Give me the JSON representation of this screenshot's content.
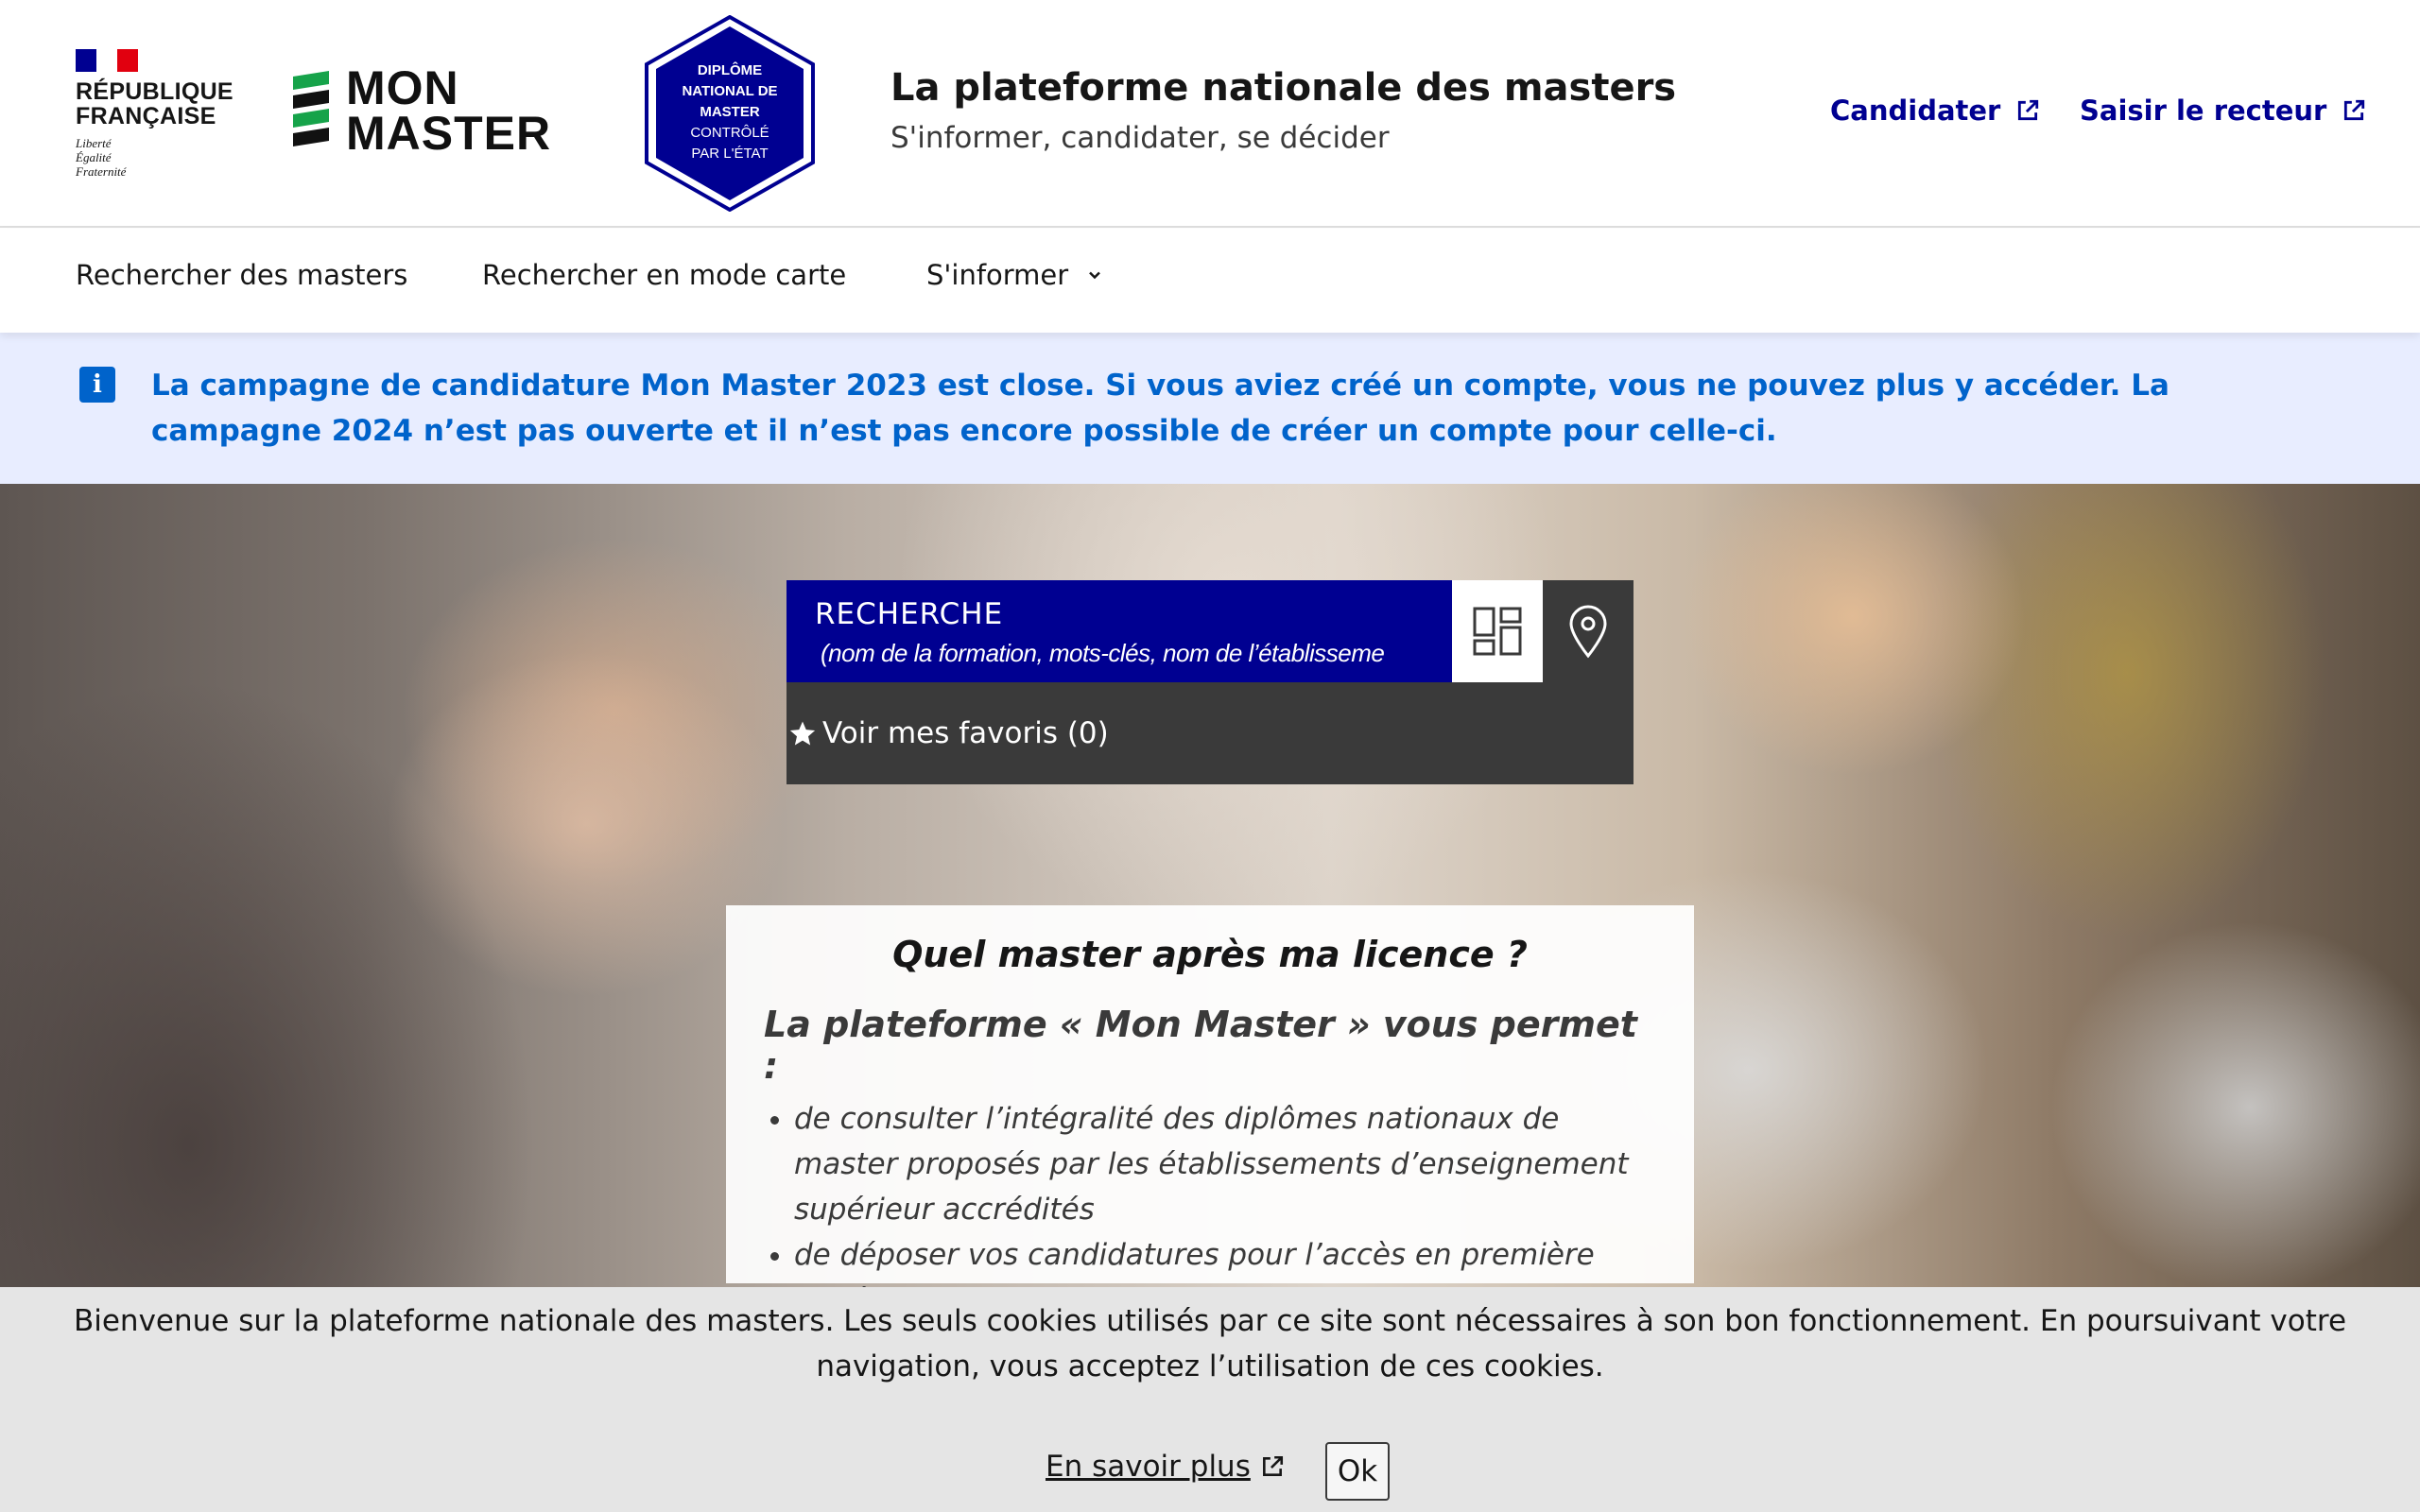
{
  "header": {
    "rf": {
      "title_line1": "RÉPUBLIQUE",
      "title_line2": "FRANÇAISE",
      "motto1": "Liberté",
      "motto2": "Égalité",
      "motto3": "Fraternité"
    },
    "brand": {
      "line1": "MON",
      "line2": "MASTER"
    },
    "badge": {
      "line1": "DIPLÔME",
      "line2": "NATIONAL DE",
      "line3": "MASTER",
      "line4": "CONTRÔLÉ",
      "line5": "PAR L'ÉTAT"
    },
    "site_title": "La plateforme nationale des masters",
    "tagline": "S'informer, candidater, se décider",
    "links": [
      {
        "label": "Candidater"
      },
      {
        "label": "Saisir le recteur"
      }
    ]
  },
  "nav": {
    "items": [
      {
        "label": "Rechercher des masters"
      },
      {
        "label": "Rechercher en mode carte"
      },
      {
        "label": "S'informer"
      }
    ]
  },
  "notice": {
    "text": "La campagne de candidature Mon Master 2023 est close. Si vous aviez créé un compte, vous ne pouvez plus y accéder. La campagne 2024 n’est pas ouverte et il n’est pas encore possible de créer un compte pour celle-ci."
  },
  "search": {
    "label": "RECHERCHE",
    "placeholder": "(nom de la formation, mots-clés, nom de l’établisseme",
    "favorites": "Voir mes favoris (0)"
  },
  "info": {
    "heading": "Quel master après ma licence ?",
    "subheading": "La plateforme « Mon Master » vous permet :",
    "items": [
      "de consulter l’intégralité des diplômes nationaux de master proposés par les établissements d’enseignement supérieur accrédités",
      "de déposer vos candidatures pour l’accès en première année de master"
    ]
  },
  "cookie": {
    "text": "Bienvenue sur la plateforme nationale des masters. Les seuls cookies utilisés par ce site sont nécessaires à son bon fonctionnement. En poursuivant votre navigation, vous acceptez l’utilisation de ces cookies.",
    "more": "En savoir plus",
    "ok": "Ok"
  },
  "colors": {
    "blue_france": "#000091",
    "info_blue": "#0063cb",
    "notice_bg": "#e8edff",
    "red_marianne": "#e1000f",
    "brand_green": "#16a34a"
  }
}
